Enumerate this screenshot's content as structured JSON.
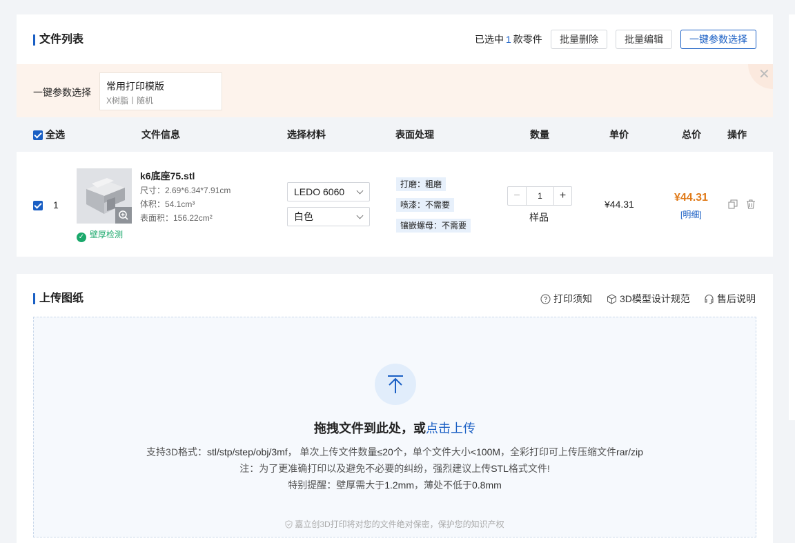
{
  "file_list": {
    "title": "文件列表",
    "selected_prefix": "已选中",
    "selected_count": "1",
    "selected_suffix": "款零件",
    "batch_delete": "批量删除",
    "batch_edit": "批量编辑",
    "one_click_params": "一键参数选择",
    "preset": {
      "label": "一键参数选择",
      "title": "常用打印模版",
      "subtitle": "X树脂丨随机"
    },
    "headers": {
      "select_all": "全选",
      "file_info": "文件信息",
      "material": "选择材料",
      "surface": "表面处理",
      "quantity": "数量",
      "unit_price": "单价",
      "total_price": "总价",
      "actions": "操作"
    },
    "row": {
      "index": "1",
      "filename": "k6底座75.stl",
      "size": "尺寸：2.69*6.34*7.91cm",
      "volume": "体积：54.1cm³",
      "area": "表面积：156.22cm²",
      "wall_check": "壁厚检测",
      "material": "LEDO 6060",
      "color": "白色",
      "surface_tags": [
        "打磨：粗磨",
        "喷漆：不需要",
        "镶嵌螺母：不需要"
      ],
      "qty": "1",
      "qty_label": "样品",
      "unit_price": "¥44.31",
      "total_price": "¥44.31",
      "detail": "[明细]"
    }
  },
  "upload": {
    "title": "上传图纸",
    "links": [
      "打印须知",
      "3D模型设计规范",
      "售后说明"
    ],
    "drop_title": "拖拽文件到此处，或",
    "drop_link": "点击上传",
    "formats_label": "支持3D格式：",
    "formats": "stl/stp/step/obj/3mf",
    "formats_rest_a": "， 单次上传文件数量",
    "count_limit": "≤20个",
    "formats_rest_b": "，单个文件大小",
    "size_limit": "<100M",
    "formats_rest_c": "，全彩打印可上传压缩文件",
    "zip_formats": "rar/zip",
    "note_a": "注：为了更准确打印以及避免不必要的纠纷，强烈建议上传",
    "note_stl": "STL",
    "note_b": "格式文件!",
    "warning_a": "特别提醒：壁厚需大于",
    "warning_thick": "1.2mm",
    "warning_b": "，薄处不低于",
    "warning_thin": "0.8mm",
    "footer": "嘉立创3D打印将对您的文件绝对保密，保护您的知识产权"
  },
  "colors": {
    "accent": "#1a5fc4",
    "price": "#e07a18",
    "success": "#1aa86b"
  },
  "icons": [
    "checkbox-checked-icon",
    "zoom-icon",
    "check-circle-icon",
    "chevron-down-icon",
    "copy-icon",
    "trash-icon",
    "question-circle-icon",
    "cube-icon",
    "headset-icon",
    "upload-arrow-icon",
    "shield-icon",
    "close-icon"
  ]
}
